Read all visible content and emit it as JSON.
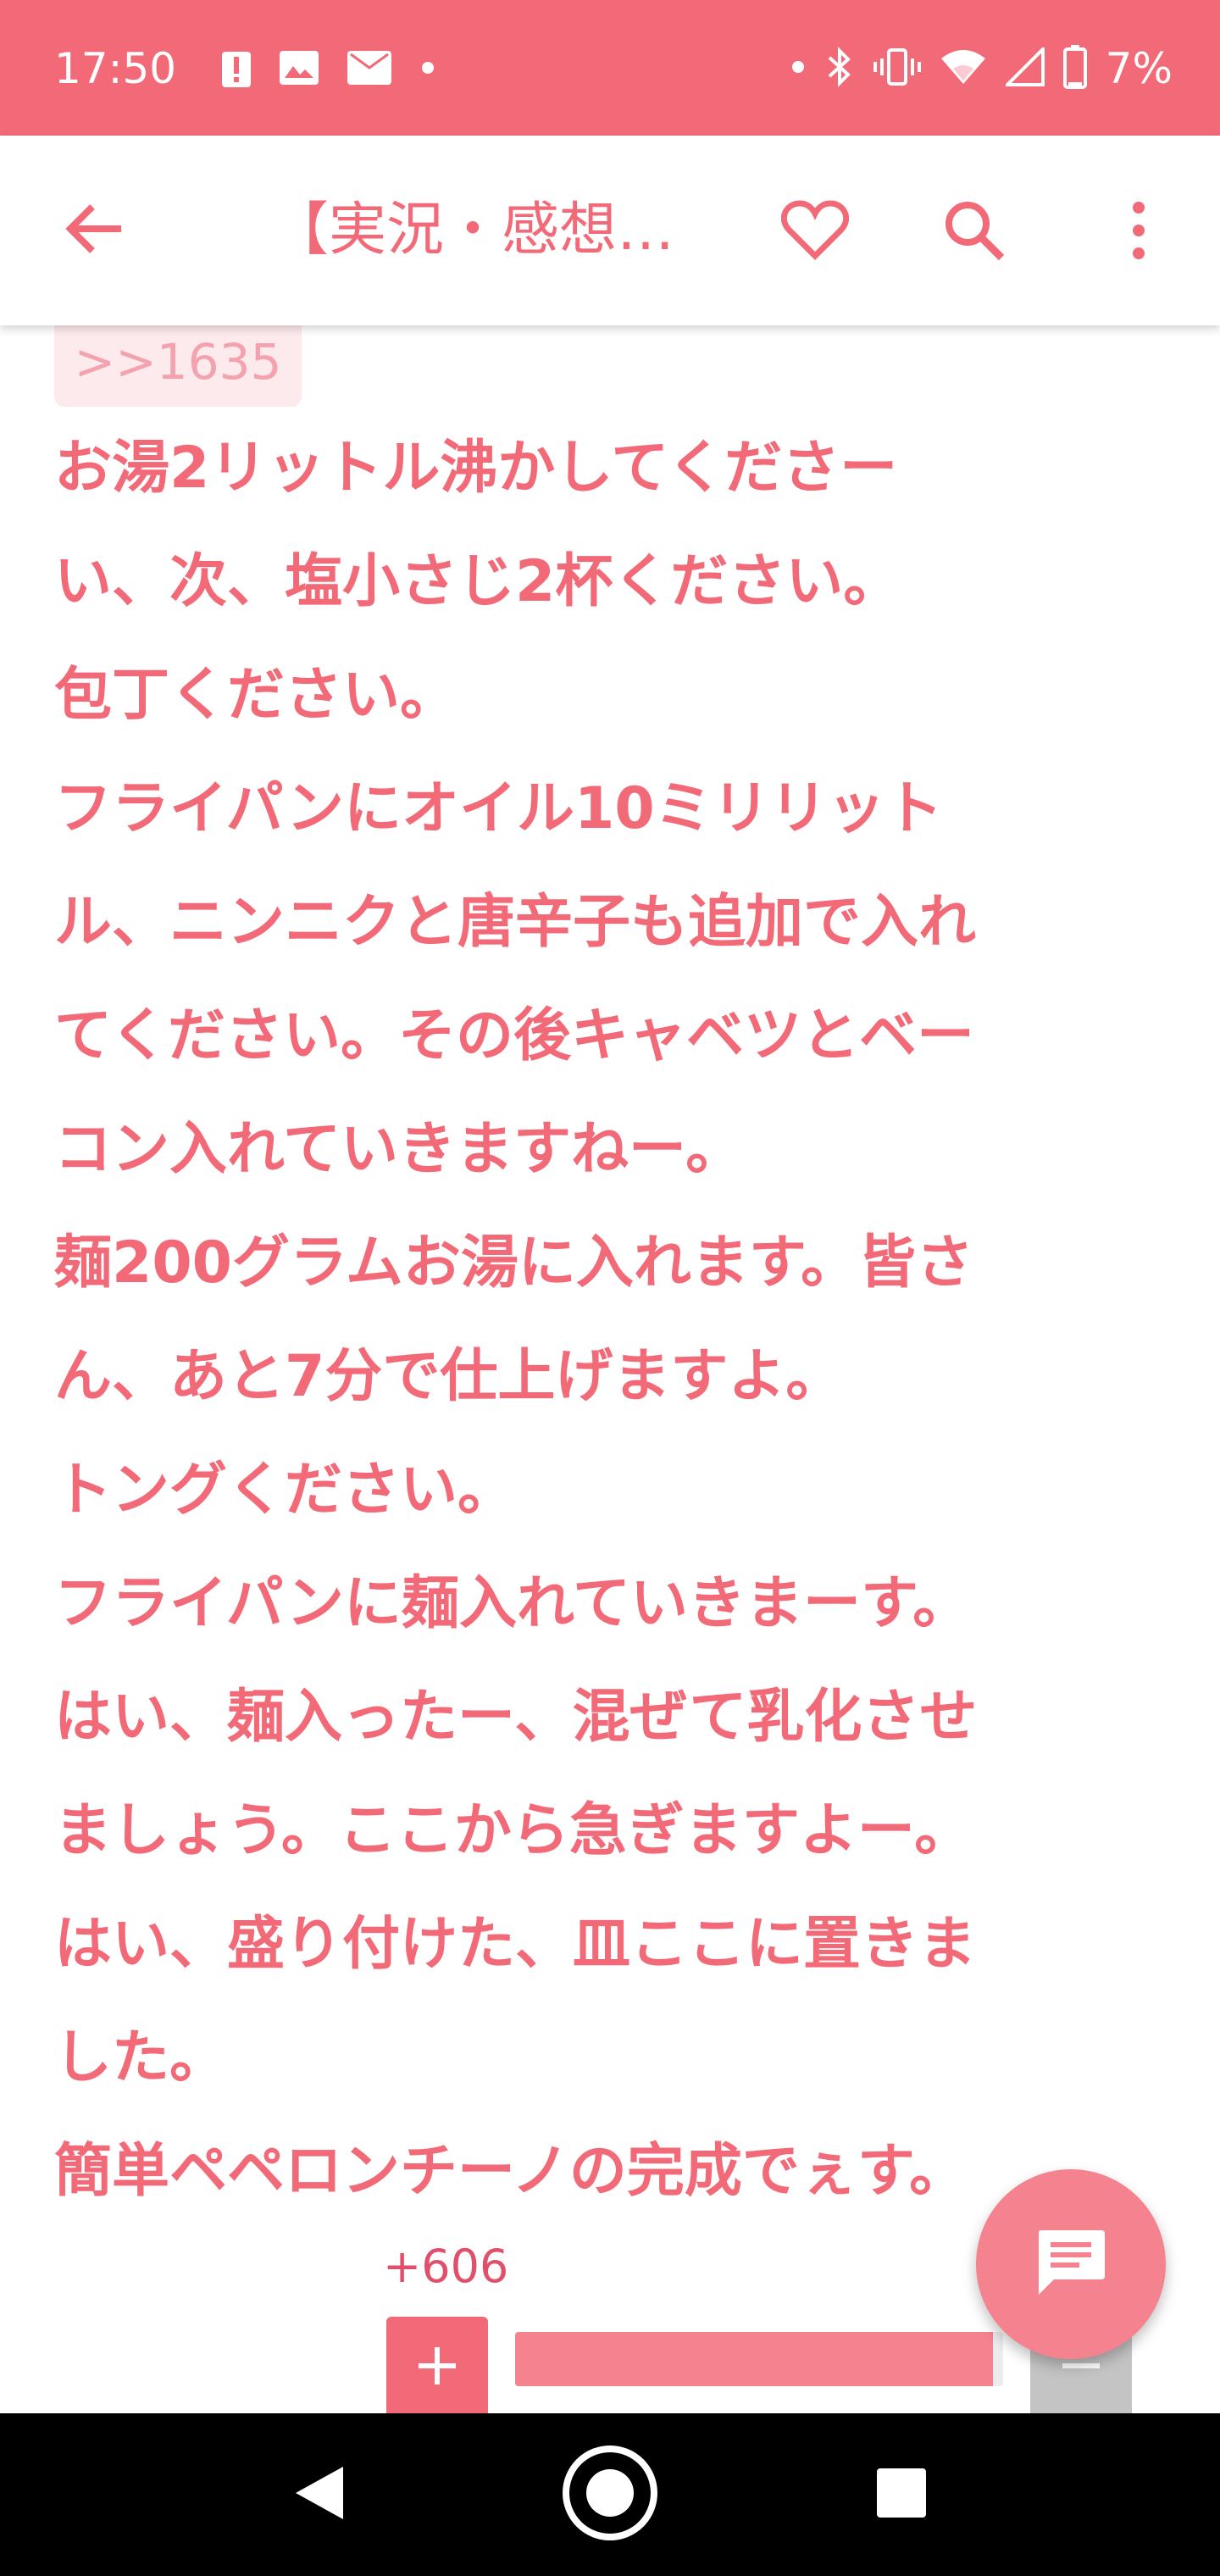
{
  "status_bar": {
    "time": "17:50",
    "battery_percent": "7%",
    "left_icons": [
      "alert-icon",
      "image-icon",
      "au-mail-icon",
      "dot-icon"
    ],
    "right_icons": [
      "dot-icon",
      "bluetooth-icon",
      "vibrate-icon",
      "wifi-icon",
      "signal-icon",
      "battery-icon"
    ],
    "background_color": "#f26a78"
  },
  "app_bar": {
    "title": "【実況・感想…",
    "icons": [
      "back-arrow-icon",
      "heart-icon",
      "search-icon",
      "more-vert-icon"
    ],
    "accent_color": "#f26a78"
  },
  "post": {
    "reply_anchor": ">>1635",
    "lines": [
      "お湯2リットル沸かしてくださー",
      "い、次、塩小さじ2杯ください。",
      "包丁ください。",
      "フライパンにオイル10ミリリット",
      "ル、ニンニクと唐辛子も追加で入れ",
      "てください。その後キャベツとベー",
      "コン入れていきますねー。",
      "麺200グラムお湯に入れます。皆さ",
      "ん、あと7分で仕上げますよ。",
      "トングください。",
      "フライパンに麺入れていきまーす。",
      "はい、麺入ったー、混ぜて乳化させ",
      "ましょう。ここから急ぎますよー。",
      "はい、盛り付けた、皿ここに置きま",
      "した。",
      "簡単ペペロンチーノの完成でぇす。"
    ],
    "text_color": "#f26a78"
  },
  "votes": {
    "count_label": "+606",
    "plus_label": "+",
    "minus_label": "−",
    "positive_fraction": 0.98,
    "bar_color": "#f4838f"
  },
  "fab": {
    "icon": "comment-icon"
  },
  "nav_bar": {
    "icons": [
      "nav-back-icon",
      "nav-home-icon",
      "nav-recents-icon"
    ]
  }
}
